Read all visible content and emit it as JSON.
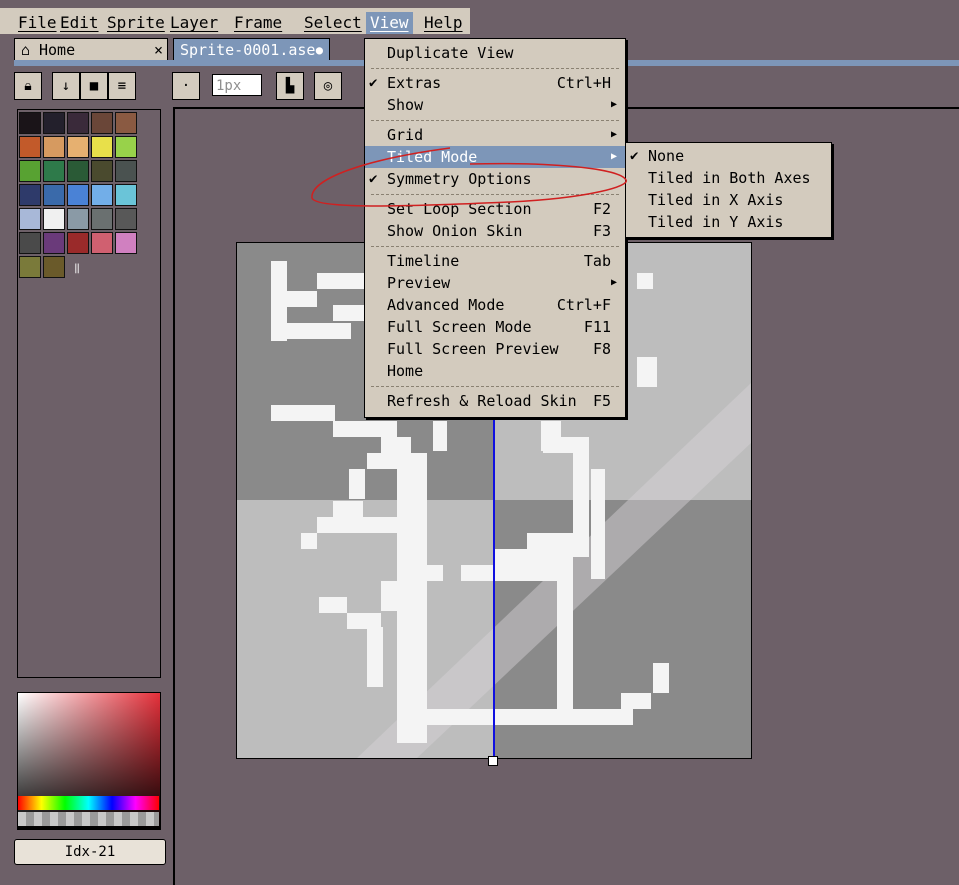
{
  "menubar": {
    "items": [
      {
        "label": "File"
      },
      {
        "label": "Edit"
      },
      {
        "label": "Sprite"
      },
      {
        "label": "Layer"
      },
      {
        "label": "Frame"
      },
      {
        "label": "Select"
      },
      {
        "label": "View"
      },
      {
        "label": "Help"
      }
    ]
  },
  "tabs": [
    {
      "label": "Home",
      "close": "×"
    },
    {
      "label": "Sprite-0001.ase",
      "modified": "●"
    }
  ],
  "toolbar": {
    "brush_size_placeholder": "1px"
  },
  "palette": {
    "colors": [
      "#1a1418",
      "#23202c",
      "#3a2a3a",
      "#6a4638",
      "#8a5a42",
      "#c25a2a",
      "#d69a60",
      "#e6b070",
      "#e8e04a",
      "#98d24a",
      "#58a232",
      "#2e7a4a",
      "#2a5a36",
      "#4a4a2e",
      "#4a5250",
      "#2e3a6a",
      "#3a6aaa",
      "#4a82d6",
      "#72aee8",
      "#6ac4d8",
      "#a8b8d8",
      "#f0f0f0",
      "#8a9aa6",
      "#6a7070",
      "#585858",
      "#4a4a4a",
      "#6a3a7a",
      "#9a2a2a",
      "#d06070",
      "#d080c0",
      "#7a7a3a",
      "#6a5a2a"
    ]
  },
  "color_index": "Idx-21",
  "view_menu": {
    "items": [
      {
        "label": "Duplicate View",
        "shortcut": "",
        "submenu": false,
        "checked": false
      },
      {
        "label": "Extras",
        "shortcut": "Ctrl+H",
        "submenu": false,
        "checked": true
      },
      {
        "label": "Show",
        "shortcut": "",
        "submenu": true,
        "checked": false
      },
      {
        "label": "Grid",
        "shortcut": "",
        "submenu": true,
        "checked": false
      },
      {
        "label": "Tiled Mode",
        "shortcut": "",
        "submenu": true,
        "checked": false
      },
      {
        "label": "Symmetry Options",
        "shortcut": "",
        "submenu": false,
        "checked": true
      },
      {
        "label": "Set Loop Section",
        "shortcut": "F2",
        "submenu": false,
        "checked": false
      },
      {
        "label": "Show Onion Skin",
        "shortcut": "F3",
        "submenu": false,
        "checked": false
      },
      {
        "label": "Timeline",
        "shortcut": "Tab",
        "submenu": false,
        "checked": false
      },
      {
        "label": "Preview",
        "shortcut": "",
        "submenu": true,
        "checked": false
      },
      {
        "label": "Advanced Mode",
        "shortcut": "Ctrl+F",
        "submenu": false,
        "checked": false
      },
      {
        "label": "Full Screen Mode",
        "shortcut": "F11",
        "submenu": false,
        "checked": false
      },
      {
        "label": "Full Screen Preview",
        "shortcut": "F8",
        "submenu": false,
        "checked": false
      },
      {
        "label": "Home",
        "shortcut": "",
        "submenu": false,
        "checked": false
      },
      {
        "label": "Refresh & Reload Skin",
        "shortcut": "F5",
        "submenu": false,
        "checked": false
      }
    ]
  },
  "tiled_submenu": {
    "items": [
      {
        "label": "None",
        "checked": true
      },
      {
        "label": "Tiled in Both Axes",
        "checked": false
      },
      {
        "label": "Tiled in X Axis",
        "checked": false
      },
      {
        "label": "Tiled in Y Axis",
        "checked": false
      }
    ]
  },
  "colors": {
    "accent": "#7d96b8",
    "panel": "#d3cbbe",
    "background": "#6d6068",
    "annotation": "#d02020",
    "symmetry_line": "#1010e0"
  }
}
